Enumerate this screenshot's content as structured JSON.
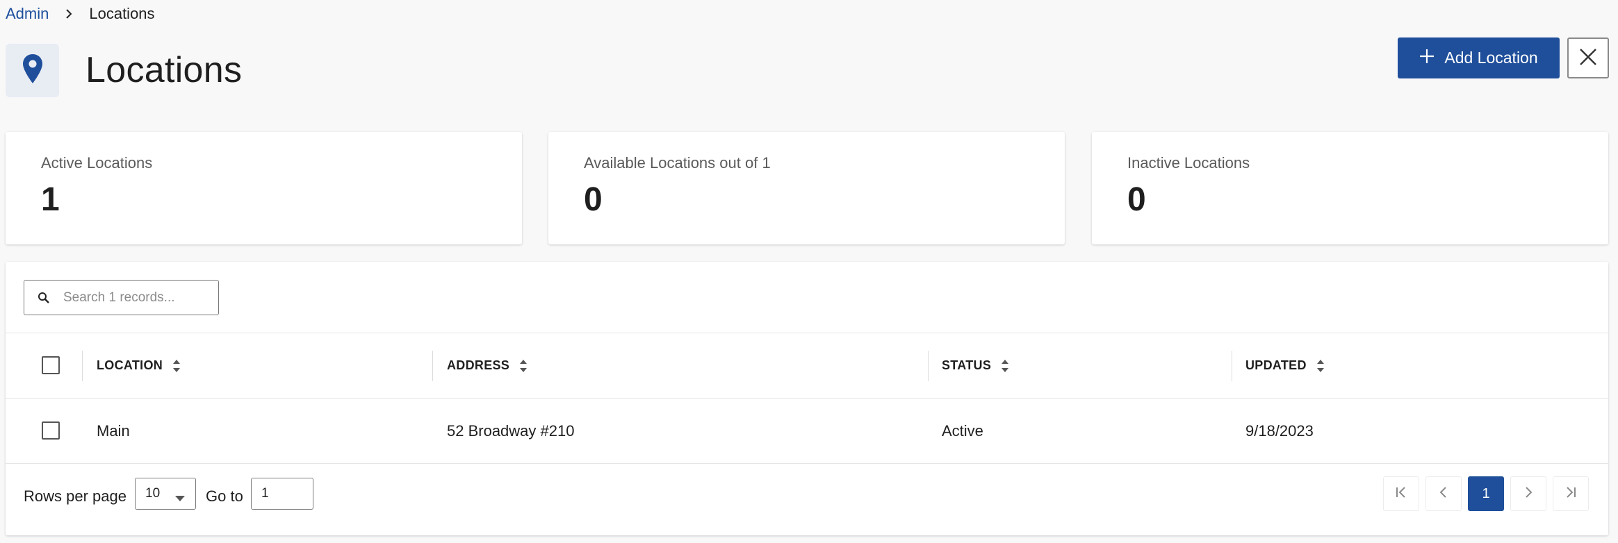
{
  "breadcrumb": {
    "root": "Admin",
    "current": "Locations"
  },
  "page": {
    "title": "Locations",
    "icon": "map-pin-icon"
  },
  "actions": {
    "add_label": "Add Location",
    "add_icon": "plus-icon",
    "close_icon": "close-icon"
  },
  "stats": [
    {
      "label": "Active Locations",
      "value": "1"
    },
    {
      "label": "Available Locations out of 1",
      "value": "0"
    },
    {
      "label": "Inactive Locations",
      "value": "0"
    }
  ],
  "search": {
    "placeholder": "Search 1 records...",
    "value": "",
    "icon": "search-icon"
  },
  "table": {
    "columns": [
      "LOCATION",
      "ADDRESS",
      "STATUS",
      "UPDATED"
    ],
    "rows": [
      {
        "location": "Main",
        "address": "52 Broadway #210",
        "status": "Active",
        "updated": "9/18/2023"
      }
    ]
  },
  "pagination": {
    "rows_per_page_label": "Rows per page",
    "rows_per_page_value": "10",
    "goto_label": "Go to",
    "goto_value": "1",
    "current_page": "1"
  },
  "colors": {
    "primary": "#1f4f9b",
    "link": "#1d4f9c",
    "icon_bg": "#e8edf4",
    "page_bg": "#f8f8f9"
  }
}
